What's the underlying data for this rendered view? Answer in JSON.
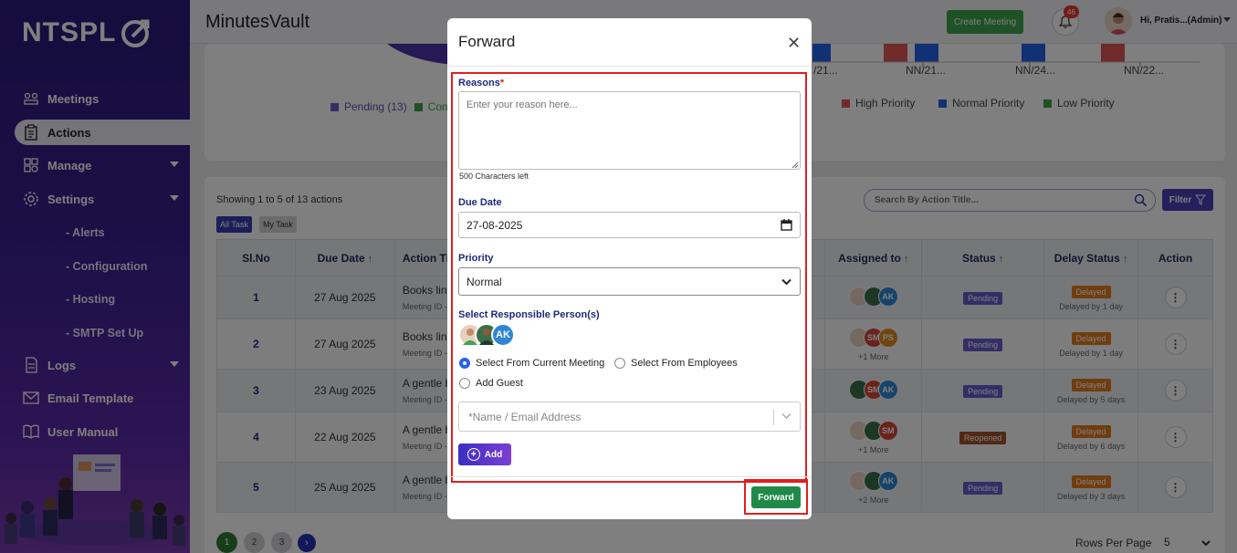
{
  "app": {
    "logo_text": "NTSPL",
    "title": "MinutesVault"
  },
  "header": {
    "create_meeting": "Create Meeting",
    "notification_count": "46",
    "user_greeting": "Hi, Pratis...(Admin)"
  },
  "sidebar": {
    "items": [
      {
        "label": "Meetings",
        "icon": "meetings-icon"
      },
      {
        "label": "Actions",
        "icon": "clipboard-icon"
      },
      {
        "label": "Manage",
        "icon": "manage-icon"
      },
      {
        "label": "Settings",
        "icon": "gear-icon"
      },
      {
        "label": "Logs",
        "icon": "logs-icon"
      },
      {
        "label": "Email Template",
        "icon": "mail-icon"
      },
      {
        "label": "User Manual",
        "icon": "book-icon"
      }
    ],
    "settings_sub": [
      "- Alerts",
      "- Configuration",
      "- Hosting",
      "- SMTP Set Up"
    ]
  },
  "chart_section": {
    "legend_left": "Pending (13)",
    "legend_left_partial": "Comp",
    "x_labels": [
      "/21...",
      "NN/21...",
      "NN/24...",
      "NN/22..."
    ],
    "legend": [
      {
        "label": "High Priority",
        "color": "#e05454"
      },
      {
        "label": "Normal Priority",
        "color": "#2563eb"
      },
      {
        "label": "Low Priority",
        "color": "#3fa34d"
      }
    ]
  },
  "actions_list": {
    "showing": "Showing 1 to 5 of 13 actions",
    "tab_all": "All Task",
    "tab_my": "My Task",
    "search_placeholder": "Search By Action Title...",
    "filter": "Filter",
    "headers": {
      "slno": "Sl.No",
      "due_date": "Due Date",
      "action_title": "Action Tit",
      "assigned_to": "Assigned to",
      "status": "Status",
      "delay_status": "Delay Status",
      "action": "Action"
    },
    "rows": [
      {
        "no": "1",
        "due": "27 Aug 2025",
        "title": "Books line",
        "meeting": "Meeting ID -",
        "more": "",
        "status": "Pending",
        "delay": "Delayed",
        "delay_by": "Delayed by 1 day"
      },
      {
        "no": "2",
        "due": "27 Aug 2025",
        "title": "Books line",
        "meeting": "Meeting ID -",
        "more": "+1 More",
        "status": "Pending",
        "delay": "Delayed",
        "delay_by": "Delayed by 1 day"
      },
      {
        "no": "3",
        "due": "23 Aug 2025",
        "title": "A gentle b",
        "meeting": "Meeting ID -",
        "more": "",
        "status": "Pending",
        "delay": "Delayed",
        "delay_by": "Delayed by 5 days"
      },
      {
        "no": "4",
        "due": "22 Aug 2025",
        "title": "A gentle b",
        "meeting": "Meeting ID -",
        "more": "+1 More",
        "status": "Reopened",
        "delay": "Delayed",
        "delay_by": "Delayed by 6 days"
      },
      {
        "no": "5",
        "due": "25 Aug 2025",
        "title": "A gentle b",
        "meeting": "Meeting ID -",
        "more": "+2 More",
        "status": "Pending",
        "delay": "Delayed",
        "delay_by": "Delayed by 3 days"
      }
    ],
    "avatar_initials": [
      "AK",
      "SM",
      "PS"
    ],
    "pages": [
      "1",
      "2",
      "3"
    ],
    "rows_per_page_label": "Rows Per Page",
    "rows_per_page_value": "5"
  },
  "modal": {
    "title": "Forward",
    "reasons_label": "Reasons",
    "required_mark": "*",
    "reason_placeholder": "Enter your reason here...",
    "chars_left": "500 Characters left",
    "due_date_label": "Due Date",
    "due_date_value": "27-08-2025",
    "priority_label": "Priority",
    "priority_value": "Normal",
    "responsible_label": "Select Responsible Person(s)",
    "responsible_initials": "AK",
    "radio_current": "Select From Current Meeting",
    "radio_employees": "Select From Employees",
    "radio_guest": "Add Guest",
    "guest_placeholder": "*Name / Email Address",
    "add_label": "Add",
    "forward_label": "Forward"
  }
}
